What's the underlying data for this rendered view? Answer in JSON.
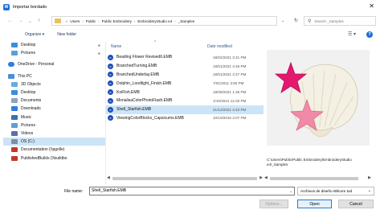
{
  "window": {
    "title": "Importar bordado",
    "close_glyph": "✕"
  },
  "address": {
    "crumbs": [
      "Users",
      "Public",
      "Public Embroidery",
      "EmbroideryStudio e4",
      "_Samples"
    ],
    "search_placeholder": "Search _Samples"
  },
  "toolbar": {
    "organize": "Organize ▾",
    "new_folder": "New folder"
  },
  "sidebar": {
    "items": [
      {
        "label": "Desktop",
        "icon": "desktop-icon",
        "color": "#3b8edb"
      },
      {
        "label": "Pictures",
        "icon": "pictures-icon",
        "color": "#5aa0d8"
      },
      {
        "label": "OneDrive - Personal",
        "icon": "onedrive-icon",
        "color": "#2f7de1"
      },
      {
        "label": "This PC",
        "icon": "computer-icon",
        "color": "#4a8fd6"
      },
      {
        "label": "3D Objects",
        "icon": "3d-objects-icon",
        "color": "#6aa9e0"
      },
      {
        "label": "Desktop",
        "icon": "desktop-icon",
        "color": "#3b8edb"
      },
      {
        "label": "Documents",
        "icon": "documents-icon",
        "color": "#8aa5c4"
      },
      {
        "label": "Downloads",
        "icon": "downloads-icon",
        "color": "#2f7de1"
      },
      {
        "label": "Music",
        "icon": "music-icon",
        "color": "#3d6fb8"
      },
      {
        "label": "Pictures",
        "icon": "pictures-icon",
        "color": "#5aa0d8"
      },
      {
        "label": "Videos",
        "icon": "videos-icon",
        "color": "#5b6fb0"
      },
      {
        "label": "OS (C:)",
        "icon": "drive-icon",
        "color": "#7f8ea3"
      },
      {
        "label": "Documentation (\\\\pgolle)",
        "icon": "network-drive-icon",
        "color": "#c0392b"
      },
      {
        "label": "PublishedBuilds (\\\\buildbo",
        "icon": "network-drive-icon",
        "color": "#c0392b"
      }
    ]
  },
  "filelist": {
    "headers": {
      "name": "Name",
      "date": "Date modified"
    },
    "files": [
      {
        "name": "Beading Flower Revised6.EMB",
        "date": "18/02/2021 3:41 PM"
      },
      {
        "name": "BranchedTurning.EMB",
        "date": "18/01/2021 4:46 PM"
      },
      {
        "name": "BranchedUnderlay.EMB",
        "date": "18/01/2021 4:47 PM"
      },
      {
        "name": "Dolphin_Loodlight_Finish.EMB",
        "date": "7/01/2011 3:50 PM"
      },
      {
        "name": "KoiFish.EMB",
        "date": "18/08/2021 1:35 PM"
      },
      {
        "name": "MonalisaColorPhotoFlash.EMB",
        "date": "1/10/2021 12:33 PM"
      },
      {
        "name": "Shell_Starfish.EMB",
        "date": "21/12/2021 4:43 PM"
      },
      {
        "name": "ViewingColorBlocks_Capsicums.EMB",
        "date": "10/10/2016 2:07 PM"
      }
    ],
    "selected_index": 6
  },
  "preview": {
    "path": "C:\\Users\\Public\\Public Embroidery\\EmbroideryStudio e4\\_Samples"
  },
  "footer": {
    "filename_label": "File name:",
    "filename_value": "Shell_Starfish.EMB",
    "filetype": "Archivos de diseño Wilcom tod",
    "options": "Options...",
    "open": "Open",
    "cancel": "Cancel"
  },
  "colors": {
    "accent": "#1e6fd9",
    "selection": "#cce4f7",
    "starfish_pink": "#e2196e",
    "starfish_light": "#f08aa6",
    "shell": "#f3efe3"
  }
}
